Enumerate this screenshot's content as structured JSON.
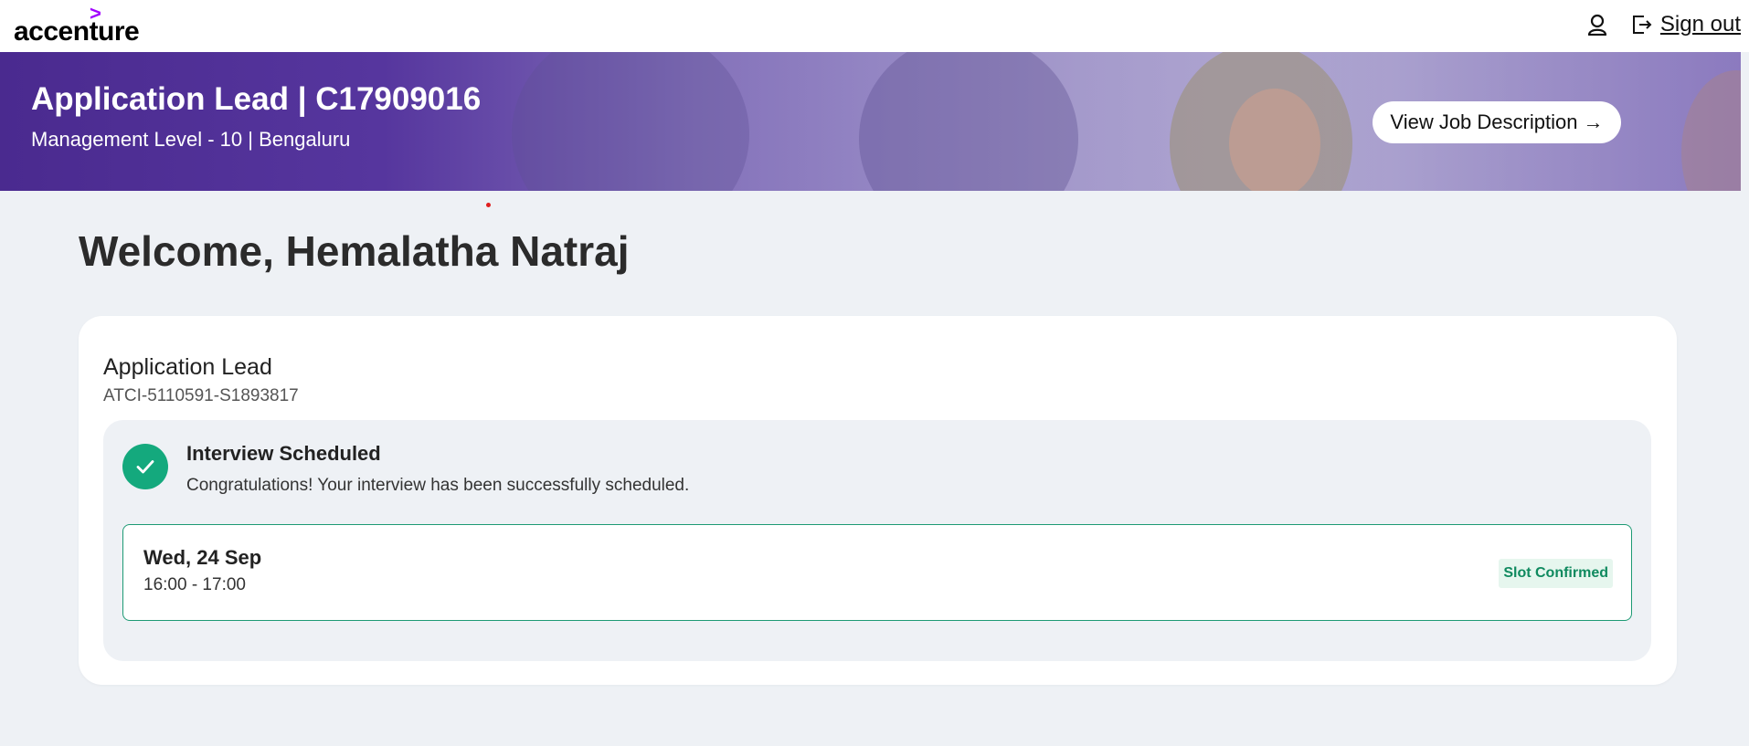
{
  "header": {
    "logo_text": "accenture",
    "logo_mark": ">",
    "account_icon": "user-icon",
    "signout_icon": "sign-out-icon",
    "signout_label": "Sign out"
  },
  "banner": {
    "title": "Application Lead | C17909016",
    "subtitle": "Management Level - 10 | Bengaluru",
    "jd_button_label": "View Job Description →"
  },
  "welcome": {
    "text": "Welcome, Hemalatha Natraj"
  },
  "application": {
    "title": "Application Lead",
    "id": "ATCI-5110591-S1893817",
    "status": {
      "icon": "check-icon",
      "title": "Interview Scheduled",
      "message": "Congratulations! Your interview has been successfully scheduled."
    },
    "slot": {
      "date": "Wed, 24 Sep",
      "time": "16:00 - 17:00",
      "badge": "Slot Confirmed"
    }
  },
  "colors": {
    "brand_purple": "#a100ff",
    "banner_purple": "#4a2a8f",
    "success_green": "#14a97d",
    "badge_green_text": "#0f8a5f",
    "page_background": "#eef1f5"
  }
}
